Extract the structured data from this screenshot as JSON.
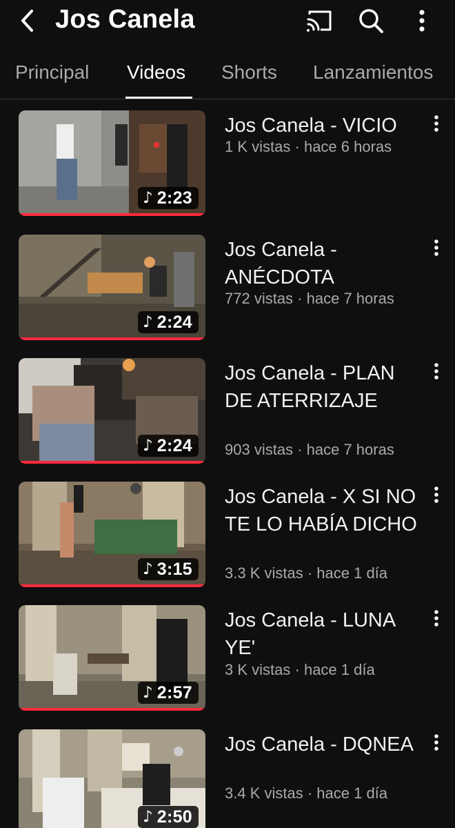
{
  "header": {
    "channel_name": "Jos Canela",
    "icons": [
      "back-arrow-icon",
      "cast-icon",
      "search-icon",
      "more-vertical-icon"
    ]
  },
  "tabs": [
    {
      "label": "Principal",
      "active": false
    },
    {
      "label": "Videos",
      "active": true
    },
    {
      "label": "Shorts",
      "active": false
    },
    {
      "label": "Lanzamientos",
      "active": false
    }
  ],
  "videos": [
    {
      "title": "Jos Canela - VICIO",
      "views": "1 K vistas",
      "separator": "·",
      "age": "hace 6 horas",
      "duration": "2:23",
      "icon": "music-note-icon"
    },
    {
      "title": "Jos Canela - ANÉCDOTA",
      "views": "772 vistas",
      "separator": "·",
      "age": "hace 7 horas",
      "duration": "2:24",
      "icon": "music-note-icon"
    },
    {
      "title": "Jos Canela - PLAN DE ATERRIZAJE",
      "views": "903 vistas",
      "separator": "·",
      "age": "hace 7 horas",
      "duration": "2:24",
      "icon": "music-note-icon"
    },
    {
      "title": "Jos Canela - X SI NO TE LO HABÍA DICHO",
      "views": "3.3 K vistas",
      "separator": "·",
      "age": "hace 1 día",
      "duration": "3:15",
      "icon": "music-note-icon"
    },
    {
      "title": "Jos Canela - LUNA YE'",
      "views": "3 K vistas",
      "separator": "·",
      "age": "hace 1 día",
      "duration": "2:57",
      "icon": "music-note-icon"
    },
    {
      "title": "Jos Canela - DQNEA",
      "views": "3.4 K vistas",
      "separator": "·",
      "age": "hace 1 día",
      "duration": "2:50",
      "icon": "music-note-icon"
    }
  ],
  "colors": {
    "background": "#0f0f0f",
    "text_primary": "#f1f1f1",
    "text_secondary": "#aaaaaa",
    "progress": "#ff2a3d",
    "divider": "#3a3a3a"
  }
}
